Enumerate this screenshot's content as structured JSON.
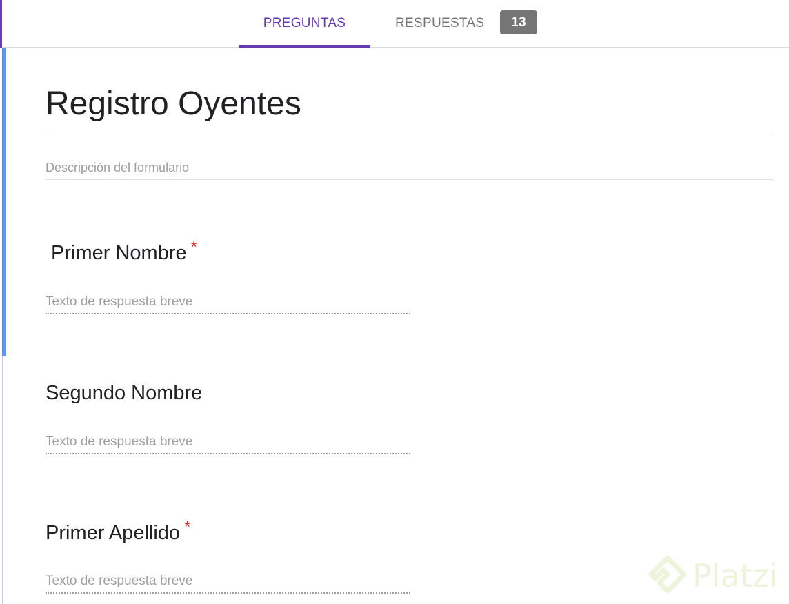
{
  "tabs": {
    "questions_label": "PREGUNTAS",
    "responses_label": "RESPUESTAS",
    "responses_count": "13"
  },
  "form": {
    "title": "Registro Oyentes",
    "description_placeholder": "Descripción del formulario"
  },
  "questions": [
    {
      "title": "Primer Nombre",
      "required": "*",
      "answer_placeholder": "Texto de respuesta breve"
    },
    {
      "title": "Segundo Nombre",
      "required": "",
      "answer_placeholder": "Texto de respuesta breve"
    },
    {
      "title": "Primer Apellido",
      "required": "*",
      "answer_placeholder": "Texto de respuesta breve"
    }
  ],
  "watermark": {
    "text": "Platzi"
  },
  "colors": {
    "accent": "#673ab7",
    "focus": "#4285f4",
    "required": "#d93025",
    "badge": "#757575"
  }
}
